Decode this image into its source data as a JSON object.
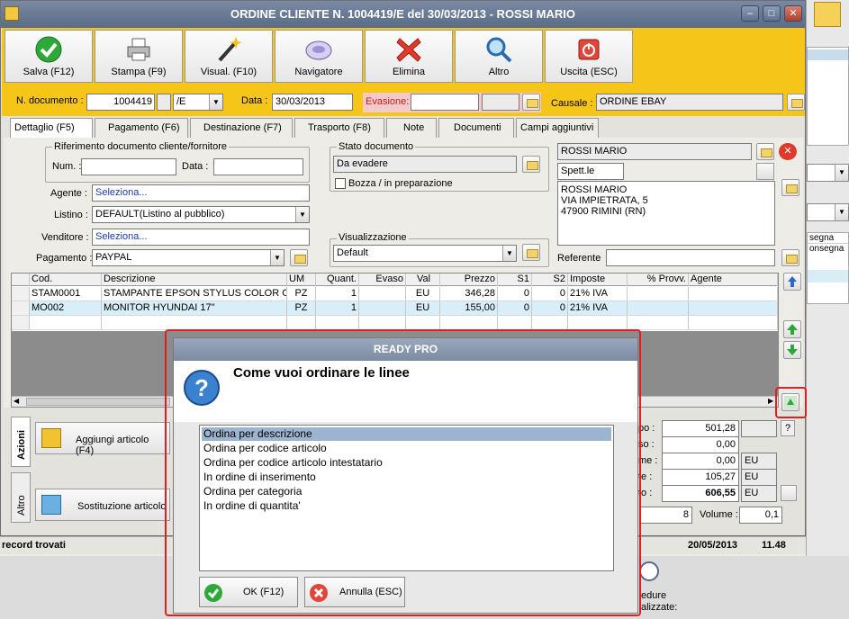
{
  "window": {
    "title": "ORDINE CLIENTE N. 1004419/E del 30/03/2013 - ROSSI MARIO",
    "minimize": "‒",
    "maximize": "□",
    "close": "✕"
  },
  "toolbar": [
    {
      "label": "Salva (F12)",
      "icon": "check-icon"
    },
    {
      "label": "Stampa (F9)",
      "icon": "printer-icon"
    },
    {
      "label": "Visual. (F10)",
      "icon": "magic-wand-icon"
    },
    {
      "label": "Navigatore",
      "icon": "compass-icon"
    },
    {
      "label": "Elimina",
      "icon": "delete-x-icon"
    },
    {
      "label": "Altro",
      "icon": "search-icon"
    },
    {
      "label": "Uscita (ESC)",
      "icon": "exit-icon"
    }
  ],
  "header": {
    "ndoc_label": "N. documento :",
    "ndoc_value": "1004419",
    "series_value": "/E",
    "data_label": "Data :",
    "data_value": "30/03/2013",
    "evasione_label": "Evasione:",
    "evasione_value": "",
    "causale_label": "Causale :",
    "causale_value": "ORDINE EBAY"
  },
  "tabs": [
    "Dettaglio (F5)",
    "Pagamento (F6)",
    "Destinazione (F7)",
    "Trasporto (F8)",
    "Note",
    "Documenti",
    "Campi aggiuntivi"
  ],
  "form": {
    "rif_legend": "Riferimento documento cliente/fornitore",
    "num_label": "Num. :",
    "data_label": "Data :",
    "agente_label": "Agente :",
    "agente_value": "Seleziona...",
    "listino_label": "Listino :",
    "listino_value": "DEFAULT(Listino al pubblico)",
    "venditore_label": "Venditore :",
    "venditore_value": "Seleziona...",
    "pagamento_label": "Pagamento :",
    "pagamento_value": "PAYPAL",
    "stato_legend": "Stato documento",
    "stato_value": "Da evadere",
    "bozza_label": "Bozza / in preparazione",
    "visual_legend": "Visualizzazione",
    "visual_value": "Default",
    "cliente_name": "ROSSI MARIO",
    "cliente_title": "Spett.le",
    "address_lines": [
      "ROSSI MARIO",
      "VIA IMPIETRATA, 5",
      "47900 RIMINI (RN)"
    ],
    "referente_label": "Referente"
  },
  "grid": {
    "columns": [
      "Cod.",
      "Descrizione",
      "UM",
      "Quant.",
      "Evaso",
      "Val",
      "Prezzo",
      "S1",
      "S2",
      "Imposte",
      "% Provv.",
      "Agente"
    ],
    "rows": [
      [
        "STAM0001",
        "STAMPANTE EPSON STYLUS COLOR C...",
        "PZ",
        "1",
        "",
        "EU",
        "346,28",
        "0",
        "0",
        "21% IVA",
        "",
        ""
      ],
      [
        "MO002",
        "MONITOR HYUNDAI 17\"",
        "PZ",
        "1",
        "",
        "EU",
        "155,00",
        "0",
        "0",
        "21% IVA",
        "",
        ""
      ]
    ]
  },
  "actions": {
    "side_tab_1": "Azioni",
    "side_tab_2": "Altro",
    "add_label": "Aggiungi articolo (F4)",
    "replace_label": "Sostituzione articolo"
  },
  "totals": {
    "rows": [
      {
        "label": "po :",
        "value": "501,28",
        "unit": ""
      },
      {
        "label": "so :",
        "value": "0,00",
        "unit": ""
      },
      {
        "label": "me :",
        "value": "0,00",
        "unit": "EU"
      },
      {
        "label": "te :",
        "value": "105,27",
        "unit": "EU"
      },
      {
        "label": "to :",
        "value": "606,55",
        "unit": "EU"
      }
    ],
    "colli_value": "8",
    "volume_label": "Volume :",
    "volume_value": "0,1",
    "help": "?"
  },
  "status": {
    "records": "record trovati",
    "date": "20/05/2013",
    "time": "11.48"
  },
  "bg_right": {
    "header": "segna",
    "row1": "onsegna",
    "bottom1": "edure",
    "bottom2": "alizzate:"
  },
  "dialog": {
    "title": "READY PRO",
    "question": "Come vuoi ordinare le linee",
    "options": [
      "Ordina per descrizione",
      "Ordina per codice articolo",
      "Ordina per codice articolo intestatario",
      "In ordine di inserimento",
      "Ordina per categoria",
      "In ordine di quantita'"
    ],
    "selected_index": 0,
    "ok_label": "OK (F12)",
    "cancel_label": "Annulla (ESC)"
  },
  "colors": {
    "toolbar": "#f5c518",
    "selection": "#9db4d1",
    "highlight_frame": "#e02020",
    "title_bar": "#6a7b97"
  }
}
